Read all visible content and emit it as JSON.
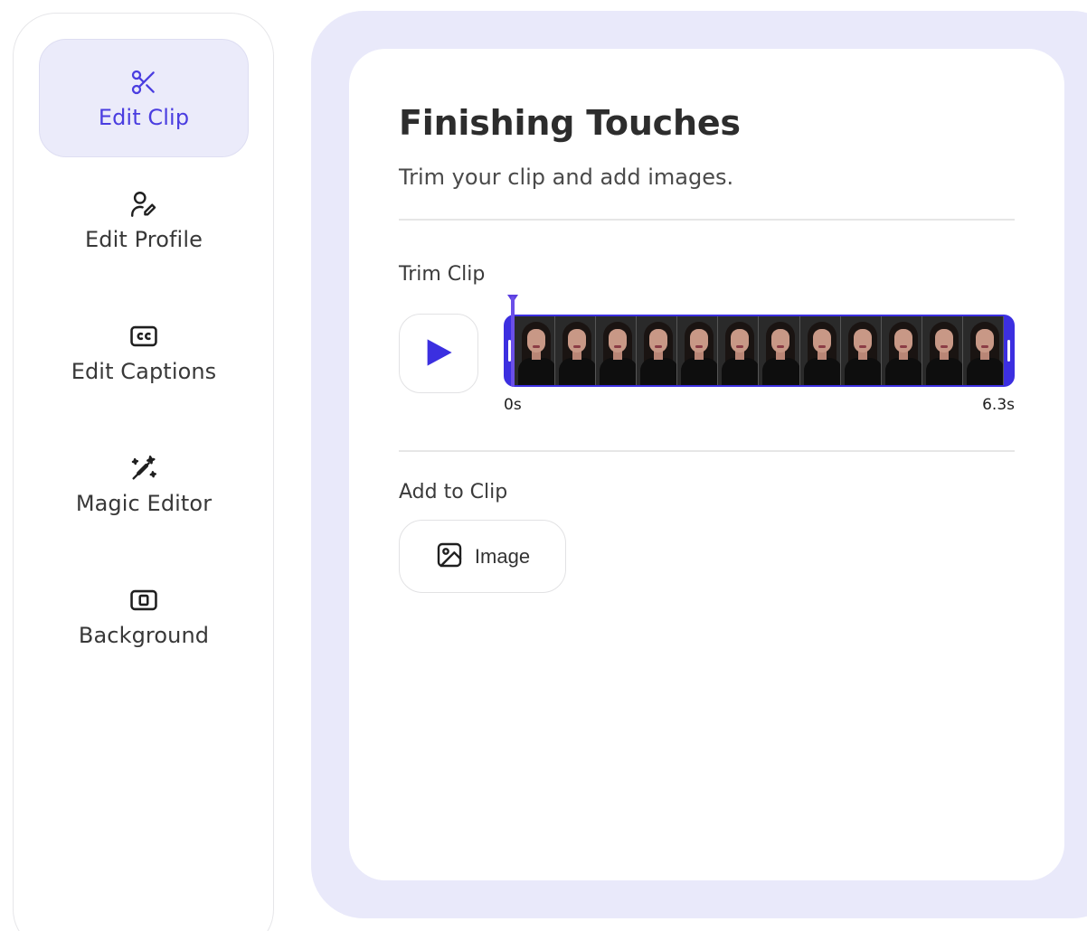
{
  "sidebar": {
    "items": [
      {
        "label": "Edit Clip",
        "icon": "scissors-icon",
        "active": true
      },
      {
        "label": "Edit Profile",
        "icon": "user-edit-icon",
        "active": false
      },
      {
        "label": "Edit Captions",
        "icon": "closed-captions-icon",
        "active": false
      },
      {
        "label": "Magic Editor",
        "icon": "magic-wand-icon",
        "active": false
      },
      {
        "label": "Background",
        "icon": "background-icon",
        "active": false
      }
    ]
  },
  "main": {
    "title": "Finishing Touches",
    "subtitle": "Trim your clip and add images.",
    "trim": {
      "label": "Trim Clip",
      "play_icon": "play-icon",
      "start_time": "0s",
      "end_time": "6.3s",
      "frame_count": 12
    },
    "add": {
      "label": "Add to Clip",
      "image_button_label": "Image",
      "image_icon": "image-icon"
    }
  },
  "colors": {
    "accent": "#4a3de0",
    "active_bg": "#ebebfa",
    "frame_bg": "#e9e9fa",
    "timeline": "#3c2fe0"
  }
}
